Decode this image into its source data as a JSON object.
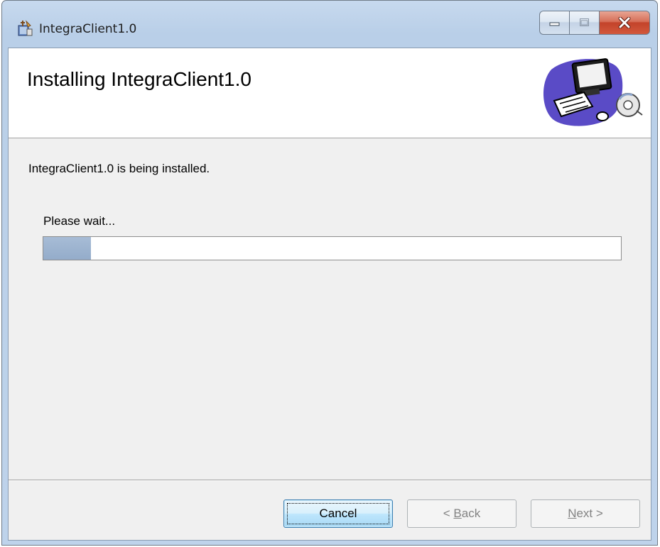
{
  "window": {
    "title": "IntegraClient1.0",
    "icon": "installer-package-icon",
    "caption_buttons": {
      "minimize_icon": "minimize-icon",
      "maximize_icon": "maximize-icon",
      "close_icon": "close-icon"
    }
  },
  "banner": {
    "title": "Installing IntegraClient1.0",
    "graphic": "computer-cd-icon"
  },
  "body": {
    "status": "IntegraClient1.0 is being installed.",
    "wait_label": "Please wait...",
    "progress_fraction": 0.083
  },
  "buttons": {
    "cancel": "Cancel",
    "back_prefix": "< ",
    "back_mnemonic": "B",
    "back_rest": "ack",
    "next_mnemonic": "N",
    "next_rest": "ext >"
  },
  "colors": {
    "progress_fill": "#a7bcd6",
    "close_button": "#c3432a",
    "title_bar": "#bed3eb"
  }
}
